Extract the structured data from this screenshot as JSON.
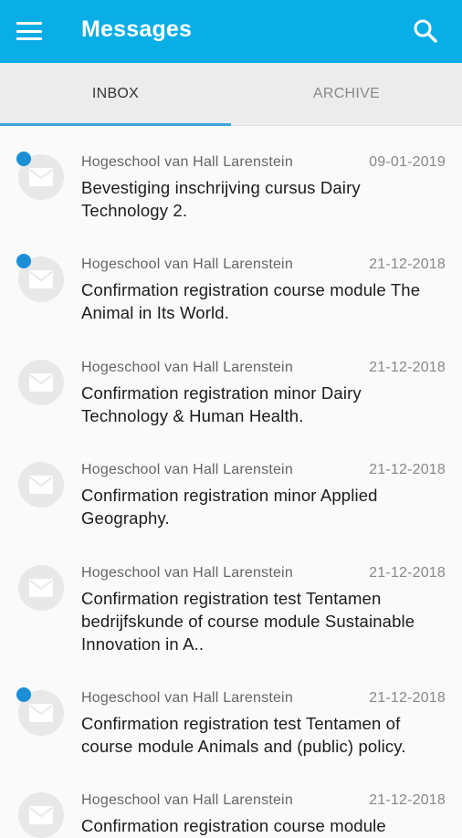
{
  "header": {
    "title": "Messages",
    "menu_icon": "hamburger-menu-icon",
    "search_icon": "search-icon",
    "color": "#0aaee6"
  },
  "tabs": [
    {
      "label": "INBOX",
      "active": true
    },
    {
      "label": "ARCHIVE",
      "active": false
    }
  ],
  "messages": [
    {
      "sender": "Hogeschool van Hall Larenstein",
      "date": "09-01-2019",
      "subject": "Bevestiging inschrijving cursus Dairy Technology 2.",
      "unread": true
    },
    {
      "sender": "Hogeschool van Hall Larenstein",
      "date": "21-12-2018",
      "subject": "Confirmation registration course module The Animal in Its World.",
      "unread": true
    },
    {
      "sender": "Hogeschool van Hall Larenstein",
      "date": "21-12-2018",
      "subject": "Confirmation registration minor Dairy Technology & Human Health.",
      "unread": false
    },
    {
      "sender": "Hogeschool van Hall Larenstein",
      "date": "21-12-2018",
      "subject": "Confirmation registration minor Applied Geography.",
      "unread": false
    },
    {
      "sender": "Hogeschool van Hall Larenstein",
      "date": "21-12-2018",
      "subject": "Confirmation registration test Tentamen bedrijfskunde of course module Sustainable Innovation in A..",
      "unread": false
    },
    {
      "sender": "Hogeschool van Hall Larenstein",
      "date": "21-12-2018",
      "subject": "Confirmation registration test Tentamen of course module Animals and (public) policy.",
      "unread": true
    },
    {
      "sender": "Hogeschool van Hall Larenstein",
      "date": "21-12-2018",
      "subject": "Confirmation registration course module",
      "unread": false
    }
  ]
}
